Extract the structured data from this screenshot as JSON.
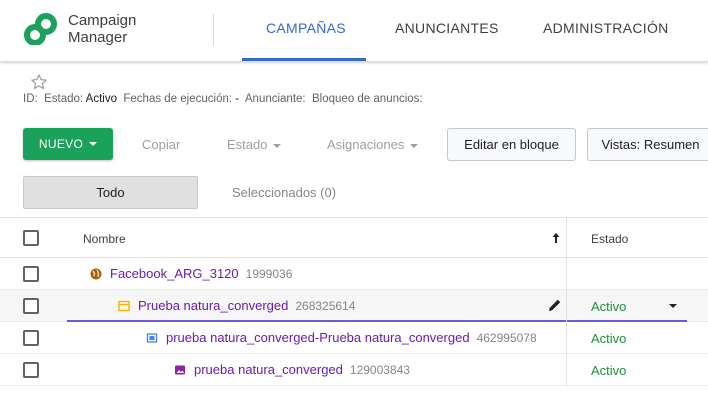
{
  "app": {
    "brand_line1": "Campaign",
    "brand_line2": "Manager"
  },
  "nav": {
    "tabs": [
      {
        "label": "CAMPAÑAS",
        "active": true
      },
      {
        "label": "ANUNCIANTES",
        "active": false
      },
      {
        "label": "ADMINISTRACIÓN",
        "active": false
      }
    ]
  },
  "info": {
    "id_label": "ID:",
    "estado_label": "Estado:",
    "estado_value": "Activo",
    "fechas_label": "Fechas de ejecución:",
    "fechas_value": "-",
    "anunciante_label": "Anunciante:",
    "bloqueo_label": "Bloqueo de anuncios:"
  },
  "toolbar": {
    "nuevo": "NUEVO",
    "copiar": "Copiar",
    "estado": "Estado",
    "asignaciones": "Asignaciones",
    "editar_bloque": "Editar en bloque",
    "vistas": "Vistas: Resumen"
  },
  "filter": {
    "todo": "Todo",
    "seleccionados": "Seleccionados (0)"
  },
  "table": {
    "headers": {
      "nombre": "Nombre",
      "estado": "Estado"
    },
    "rows": [
      {
        "name": "Facebook_ARG_3120",
        "id": "1999036",
        "state": ""
      },
      {
        "name": "Prueba natura_converged",
        "id": "268325614",
        "state": "Activo"
      },
      {
        "name": "prueba natura_converged-Prueba natura_converged",
        "id": "462995078",
        "state": "Activo"
      },
      {
        "name": "prueba natura_converged",
        "id": "129003843",
        "state": "Activo"
      }
    ]
  },
  "colors": {
    "accent": "#3367d6",
    "primary_button": "#1aa15a",
    "link": "#6a1bb0",
    "active_status": "#1e8e3e"
  }
}
